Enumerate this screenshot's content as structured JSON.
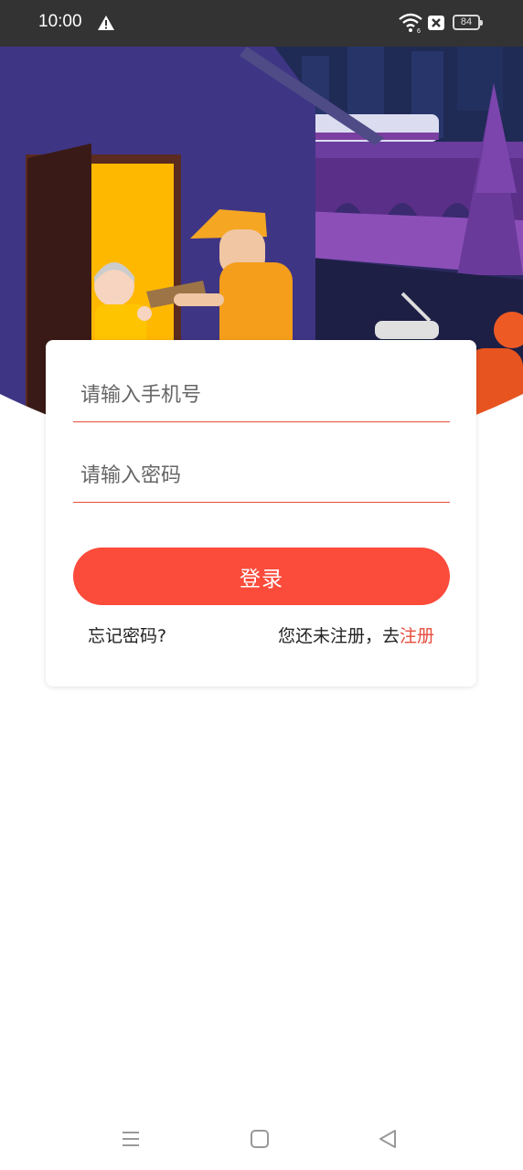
{
  "status_bar": {
    "time": "10:00",
    "battery": "84",
    "icons": [
      "warning-icon",
      "wifi-icon",
      "sim-icon",
      "battery-icon"
    ]
  },
  "banner": {
    "illustration": "courier-delivering-package-night-city"
  },
  "login_form": {
    "phone_placeholder": "请输入手机号",
    "phone_value": "",
    "password_placeholder": "请输入密码",
    "password_value": "",
    "login_label": "登录",
    "forgot_label": "忘记密码?",
    "no_account_label": "您还未注册，去",
    "register_label": "注册"
  },
  "nav_bar": {
    "icons": [
      "menu-icon",
      "home-icon",
      "back-icon"
    ]
  },
  "colors": {
    "accent": "#fb4b3b",
    "status_bar": "#333333",
    "banner_sky": "#2e2a63",
    "link": "#e74c3c"
  }
}
